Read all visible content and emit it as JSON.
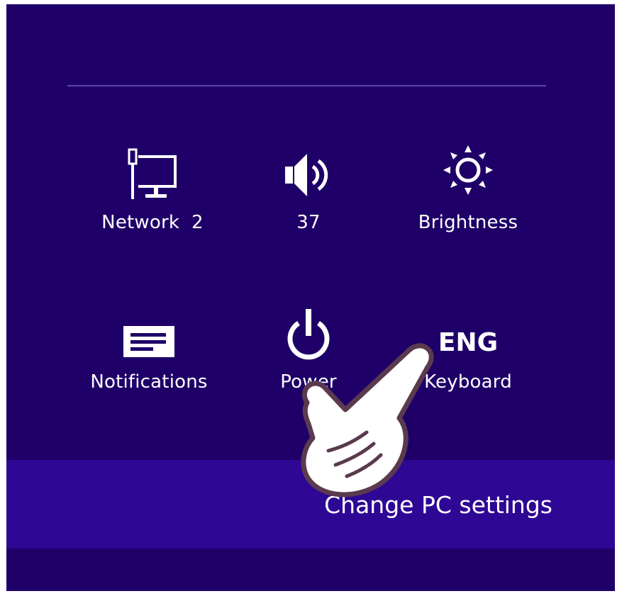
{
  "quick_settings": [
    {
      "label": "Network  2",
      "icon": "network-icon"
    },
    {
      "label": "37",
      "icon": "volume-icon"
    },
    {
      "label": "Brightness",
      "icon": "brightness-icon"
    },
    {
      "label": "Notifications",
      "icon": "notifications-icon"
    },
    {
      "label": "Power",
      "icon": "power-icon"
    },
    {
      "label": "Keyboard",
      "icon": "keyboard-language",
      "icon_text": "ENG"
    }
  ],
  "footer": {
    "change_pc_settings": "Change PC settings"
  },
  "colors": {
    "background": "#1f0068",
    "settings_bar": "#2e0795",
    "divider": "#5d46a3",
    "text": "#ffffff"
  }
}
